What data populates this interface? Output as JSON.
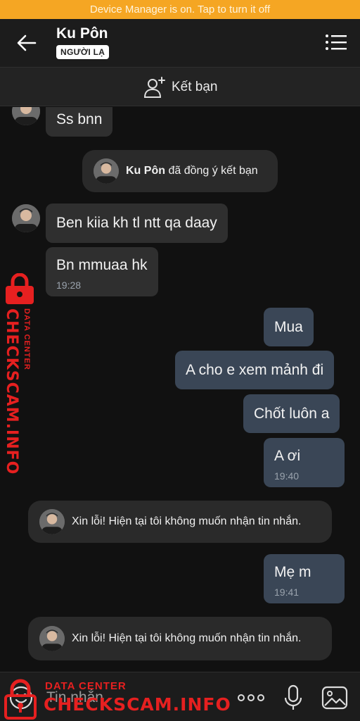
{
  "system_banner": "Device Manager is on. Tap to turn it off",
  "header": {
    "contact_name": "Ku Pôn",
    "badge": "NGƯỜI LẠ",
    "back_icon": "arrow-left-icon",
    "menu_icon": "list-menu-icon"
  },
  "add_friend": {
    "label": "Kết bạn",
    "icon": "add-person-icon"
  },
  "messages": [
    {
      "direction": "in",
      "text": "Ss bnn",
      "time": ""
    },
    {
      "direction": "system",
      "name": "Ku Pôn",
      "text": "đã đồng ý kết bạn"
    },
    {
      "direction": "in",
      "text": "Ben kiia kh tl ntt qa daay",
      "time": ""
    },
    {
      "direction": "in",
      "text": "Bn mmuaa hk",
      "time": "19:28"
    },
    {
      "direction": "out",
      "text": "Mua",
      "time": ""
    },
    {
      "direction": "out",
      "text": "A cho e xem mảnh đi",
      "time": ""
    },
    {
      "direction": "out",
      "text": "Chốt luôn a",
      "time": ""
    },
    {
      "direction": "out",
      "text": "A ơi",
      "time": "19:40"
    },
    {
      "direction": "system",
      "text": "Xin lỗi! Hiện tại tôi không muốn nhận tin nhắn."
    },
    {
      "direction": "out",
      "text": "Mẹ m",
      "time": "19:41"
    },
    {
      "direction": "system",
      "text": "Xin lỗi! Hiện tại tôi không muốn nhận tin nhắn."
    }
  ],
  "watermark": {
    "brand": "CHECKSCAM.INFO",
    "sub": "DATA CENTER"
  },
  "composer": {
    "placeholder": "Tin nhắn",
    "icons": [
      "emoji-icon",
      "more-icon",
      "microphone-icon",
      "image-icon"
    ]
  },
  "colors": {
    "banner": "#f5a623",
    "incoming_bubble": "#2f2f2f",
    "outgoing_bubble": "#3a4656",
    "watermark": "#e62020"
  }
}
